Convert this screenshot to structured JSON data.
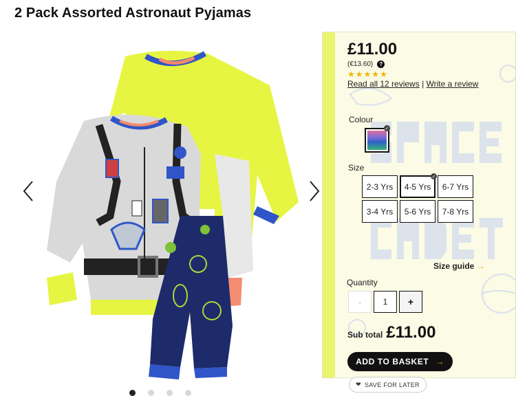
{
  "product": {
    "title": "2 Pack Assorted Astronaut Pyjamas",
    "price": "£11.00",
    "euro_price": "(€13.60)",
    "rating_stars": 5,
    "reviews_link": "Read all 12 reviews",
    "separator": "|",
    "write_review": "Write a review"
  },
  "gallery": {
    "prev_icon": "chevron-left-icon",
    "next_icon": "chevron-right-icon",
    "dots": 4,
    "active_dot": 0
  },
  "colour": {
    "label": "Colour"
  },
  "size": {
    "label": "Size",
    "options": [
      "2-3 Yrs",
      "4-5 Yrs",
      "6-7 Yrs",
      "3-4 Yrs",
      "5-6 Yrs",
      "7-8 Yrs"
    ],
    "selected": "4-5 Yrs",
    "guide": "Size guide"
  },
  "quantity": {
    "label": "Quantity",
    "minus": "-",
    "value": "1",
    "plus": "+"
  },
  "subtotal": {
    "label": "Sub total",
    "amount": "£11.00"
  },
  "actions": {
    "basket": "ADD TO BASKET",
    "save": "SAVE FOR LATER"
  },
  "colors": {
    "accent_orange": "#f0a000",
    "neon_yellow": "#e9f56f",
    "star": "#f0b400"
  }
}
